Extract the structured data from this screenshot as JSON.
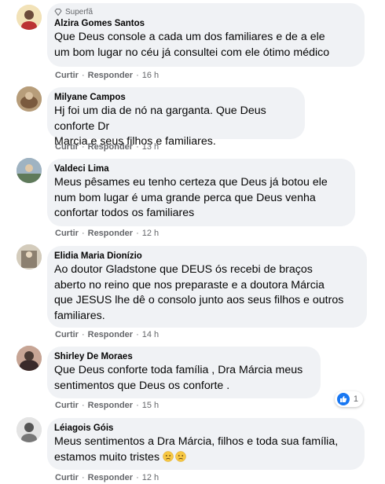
{
  "comments": [
    {
      "badge": "Superfã",
      "name": "Alzira Gomes Santos",
      "text": "Que Deus console a cada um dos familiares e de a ele\num bom lugar no céu já consultei com ele ótimo médico",
      "like": "Curtir",
      "reply": "Responder",
      "time": "16 h"
    },
    {
      "name": "Milyane Campos",
      "text": "Hj foi um dia de nó na garganta. Que Deus conforte Dr\nMarcia e seus filhos e familiares.",
      "like": "Curtir",
      "reply": "Responder",
      "time": "13 h"
    },
    {
      "name": "Valdeci Lima",
      "text": "Meus pêsames eu tenho certeza que Deus já botou ele\nnum bom lugar é uma grande perca que Deus venha\nconfortar todos os familiares",
      "like": "Curtir",
      "reply": "Responder",
      "time": "12 h"
    },
    {
      "name": "Elidia Maria Dionízio",
      "text": "Ao doutor Gladstone que DEUS ós recebi de braços\naberto no reino que nos preparaste e a doutora Márcia\nque JESUS lhe dê o consolo junto aos seus filhos e outros\nfamiliares.",
      "like": "Curtir",
      "reply": "Responder",
      "time": "14 h"
    },
    {
      "name": "Shirley De Moraes",
      "text": "Que Deus conforte toda família , Dra Márcia meus\nsentimentos que Deus os conforte .",
      "like": "Curtir",
      "reply": "Responder",
      "time": "15 h",
      "reaction_count": "1"
    },
    {
      "name": "Léiagois Góis",
      "text": "Meus sentimentos a Dra Márcia, filhos e toda sua família,\nestamos muito tristes",
      "like": "Curtir",
      "reply": "Responder",
      "time": "12 h"
    }
  ],
  "colors": {
    "bubble": "#f0f2f5",
    "meta": "#65676b",
    "like_blue": "#1877f2"
  }
}
